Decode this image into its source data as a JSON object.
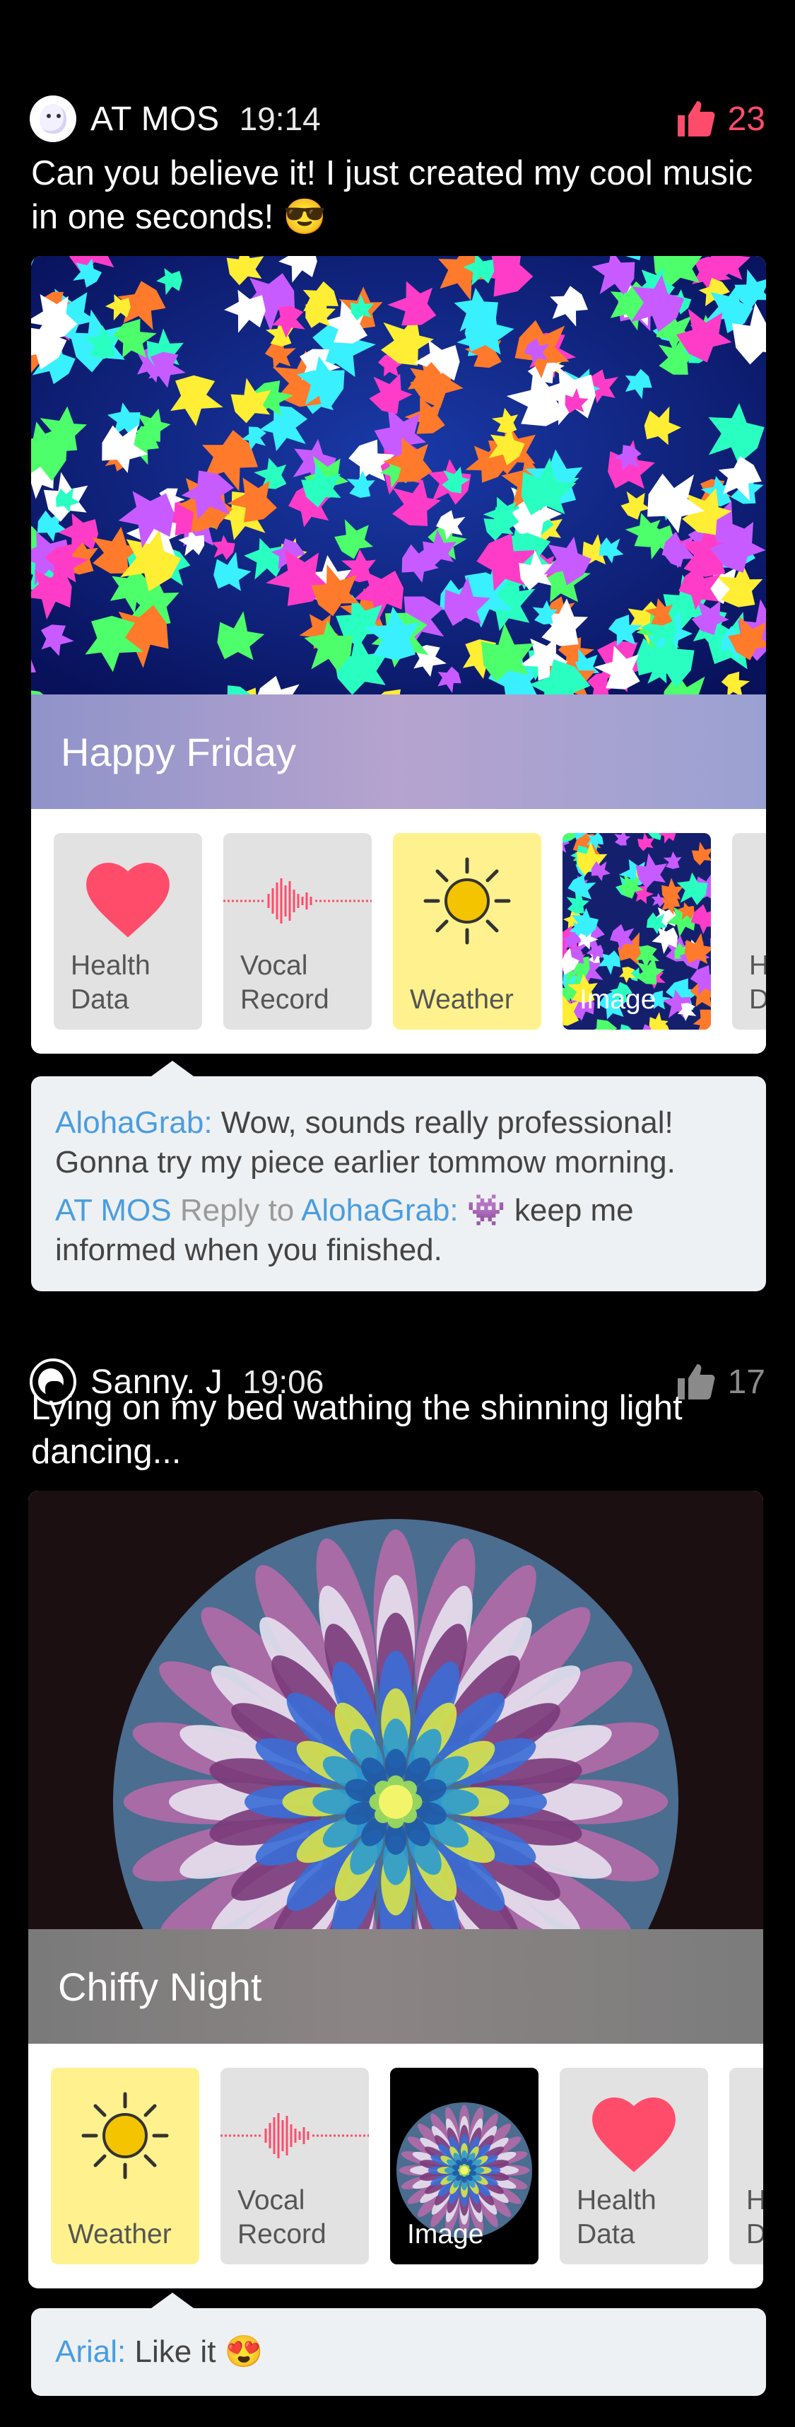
{
  "posts": [
    {
      "user": "AT MOS",
      "time": "19:14",
      "likes": "23",
      "like_color": "#ff4c6a",
      "caption": "Can you believe it! I just created my cool music in one seconds! 😎",
      "card_title": "Happy Friday",
      "tiles": [
        {
          "label": "Health\nData",
          "icon": "heart-icon"
        },
        {
          "label": "Vocal\nRecord",
          "icon": "waveform-icon"
        },
        {
          "label": "Weather",
          "icon": "sun-icon"
        },
        {
          "label": "Image",
          "icon": "image-thumbnail"
        },
        {
          "label": "H\nD",
          "icon": "partial-tile"
        }
      ],
      "comments": [
        {
          "author": "AlohaGrab:",
          "text": " Wow, sounds really professional! Gonna try my piece earlier tommow morning."
        },
        {
          "author": "AT MOS",
          "reply_word": " Reply to ",
          "target": "AlohaGrab:",
          "text": " 👾 keep me informed when you finished."
        }
      ]
    },
    {
      "user": "Sanny. J",
      "time": "19:06",
      "likes": "17",
      "like_color": "#8a8a8a",
      "caption": "Lying on my bed wathing the shinning light dancing...",
      "card_title": "Chiffy Night",
      "tiles": [
        {
          "label": "Weather",
          "icon": "sun-icon"
        },
        {
          "label": "Vocal\nRecord",
          "icon": "waveform-icon"
        },
        {
          "label": "Image",
          "icon": "image-thumbnail"
        },
        {
          "label": "Health\nData",
          "icon": "heart-icon"
        },
        {
          "label": "H\nD",
          "icon": "partial-tile"
        }
      ],
      "comments": [
        {
          "author": "Arial:",
          "text": " Like it 😍"
        }
      ]
    }
  ],
  "colors": {
    "accent_name": "#4a9de0",
    "heart": "#ff4c6a",
    "weather_bg": "#fff28e",
    "sun": "#f5c400"
  }
}
